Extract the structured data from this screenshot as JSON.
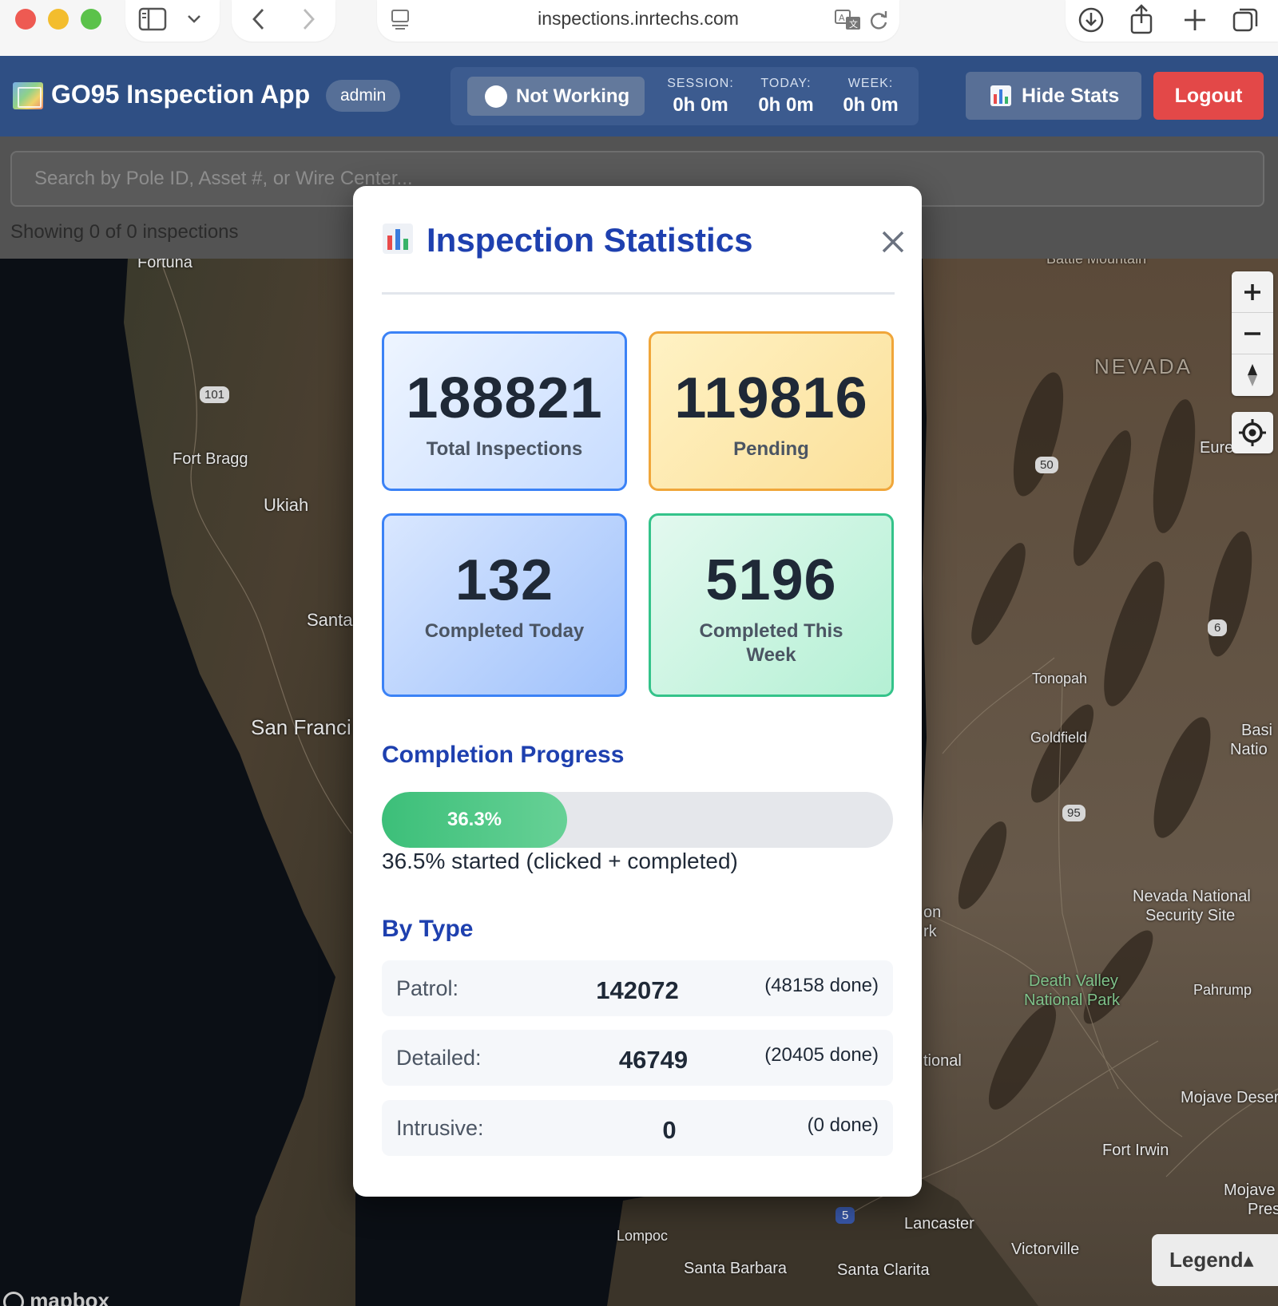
{
  "browser": {
    "url": "inspections.inrtechs.com"
  },
  "header": {
    "title": "GO95 Inspection App",
    "role": "admin",
    "work_status": "Not Working",
    "session_label": "SESSION:",
    "session_value": "0h 0m",
    "today_label": "TODAY:",
    "today_value": "0h 0m",
    "week_label": "WEEK:",
    "week_value": "0h 0m",
    "hide_stats_label": "Hide Stats",
    "logout_label": "Logout",
    "colors": {
      "header_bg": "#2f4f84",
      "logout": "#e34848"
    }
  },
  "search": {
    "placeholder": "Search by Pole ID, Asset #, or Wire Center...",
    "showing_text": "Showing 0 of 0 inspections"
  },
  "map": {
    "labels": {
      "fortuna": "Fortuna",
      "fort_bragg": "Fort Bragg",
      "ukiah": "Ukiah",
      "santa": "Santa",
      "san_franci": "San Franci",
      "hwy_101": "101",
      "nevada": "NEVADA",
      "eure": "Eure",
      "hwy_50": "50",
      "hwy_6": "6",
      "tonopah": "Tonopah",
      "goldfield": "Goldfield",
      "basin_1": "Basi",
      "basin_2": "Natio",
      "hwy_95": "95",
      "nnss_1": "Nevada National",
      "nnss_2": "Security Site",
      "on": "on",
      "rk": "rk",
      "dv_1": "Death Valley",
      "dv_2": "National Park",
      "pahrump": "Pahrump",
      "tional": "tional",
      "mojave_desert": "Mojave Deser",
      "fort_irwin": "Fort Irwin",
      "mojave_pres_1": "Mojave",
      "mojave_pres_2": "Pres",
      "hwy_5": "5",
      "lancaster": "Lancaster",
      "lompoc": "Lompoc",
      "victorville": "Victorville",
      "santa_barbara": "Santa Barbara",
      "santa_clarita": "Santa Clarita",
      "battle_mountain": "Battle Mountain"
    },
    "legend_label": "Legend▴",
    "attribution": "mapbox"
  },
  "modal": {
    "title": "Inspection Statistics",
    "cards": {
      "total": {
        "value": "188821",
        "label": "Total Inspections"
      },
      "pending": {
        "value": "119816",
        "label": "Pending"
      },
      "today": {
        "value": "132",
        "label": "Completed Today"
      },
      "week": {
        "value": "5196",
        "label": "Completed This Week"
      }
    },
    "progress": {
      "title": "Completion Progress",
      "percent": 36.3,
      "label": "36.3%",
      "started_text": "36.5% started (clicked + completed)"
    },
    "by_type": {
      "title": "By Type",
      "rows": [
        {
          "name": "Patrol:",
          "count": "142072",
          "done": "(48158 done)"
        },
        {
          "name": "Detailed:",
          "count": "46749",
          "done": "(20405 done)"
        },
        {
          "name": "Intrusive:",
          "count": "0",
          "done": "(0 done)"
        }
      ]
    }
  }
}
